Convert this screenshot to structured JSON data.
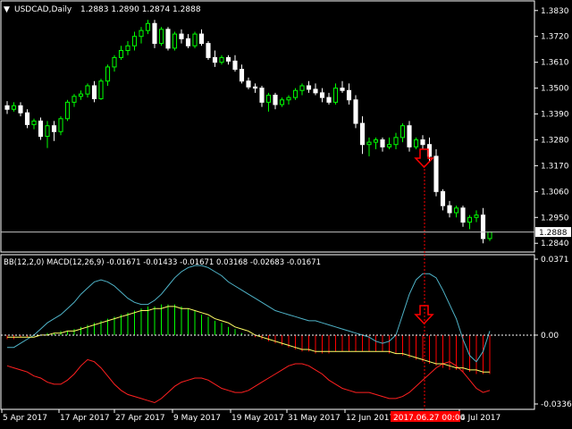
{
  "header": {
    "arrow": "▼",
    "symbol": "USDCAD,Daily",
    "ohlc": "1.2883 1.2890 1.2874 1.2888"
  },
  "price_axis": {
    "ticks": [
      "1.3830",
      "1.3720",
      "1.3610",
      "1.3500",
      "1.3390",
      "1.3280",
      "1.3170",
      "1.3060",
      "1.2950",
      "1.2840"
    ],
    "current": "1.2888"
  },
  "indicator": {
    "title": "BB(12,2,0) MACD(12,26,9) -0.01671 -0.01433 -0.01671 0.03168 -0.02683 -0.01671",
    "ticks": [
      "0.0371",
      "0.00",
      "-0.03365"
    ]
  },
  "time_axis": {
    "labels": [
      "5 Apr 2017",
      "17 Apr 2017",
      "27 Apr 2017",
      "9 May 2017",
      "19 May 2017",
      "31 May 2017",
      "12 Jun 2017",
      "4 Jul 2017"
    ],
    "crosshair_label": "2017.06.27 00:00"
  },
  "colors": {
    "bull": "#00ff00",
    "bear": "#ffffff",
    "macd_up": "#00ff00",
    "macd_down": "#ff0000",
    "bb_upper": "#4fb3c8",
    "bb_lower": "#ff2020",
    "signal": "#ffff66",
    "crosshair": "#ff0000",
    "arrow": "#ff0000"
  },
  "chart_data": {
    "type": "candlestick",
    "ohlc_order": [
      "open",
      "high",
      "low",
      "close"
    ],
    "candles": [
      [
        1.3425,
        1.3445,
        1.339,
        1.341
      ],
      [
        1.341,
        1.344,
        1.34,
        1.3425
      ],
      [
        1.3425,
        1.344,
        1.338,
        1.3395
      ],
      [
        1.3395,
        1.341,
        1.333,
        1.3345
      ],
      [
        1.3345,
        1.337,
        1.3325,
        1.336
      ],
      [
        1.336,
        1.3375,
        1.328,
        1.3295
      ],
      [
        1.3295,
        1.336,
        1.3245,
        1.334
      ],
      [
        1.334,
        1.336,
        1.3275,
        1.3315
      ],
      [
        1.3315,
        1.338,
        1.33,
        1.337
      ],
      [
        1.337,
        1.345,
        1.336,
        1.344
      ],
      [
        1.344,
        1.3475,
        1.342,
        1.3465
      ],
      [
        1.3465,
        1.349,
        1.345,
        1.3475
      ],
      [
        1.3475,
        1.352,
        1.346,
        1.351
      ],
      [
        1.351,
        1.353,
        1.344,
        1.3455
      ],
      [
        1.3455,
        1.354,
        1.345,
        1.353
      ],
      [
        1.353,
        1.36,
        1.351,
        1.359
      ],
      [
        1.359,
        1.364,
        1.357,
        1.363
      ],
      [
        1.363,
        1.368,
        1.362,
        1.366
      ],
      [
        1.366,
        1.37,
        1.364,
        1.368
      ],
      [
        1.368,
        1.374,
        1.366,
        1.372
      ],
      [
        1.372,
        1.376,
        1.369,
        1.3745
      ],
      [
        1.3745,
        1.379,
        1.373,
        1.3775
      ],
      [
        1.3775,
        1.379,
        1.367,
        1.369
      ],
      [
        1.369,
        1.376,
        1.368,
        1.375
      ],
      [
        1.375,
        1.376,
        1.366,
        1.367
      ],
      [
        1.367,
        1.374,
        1.366,
        1.373
      ],
      [
        1.373,
        1.375,
        1.369,
        1.371
      ],
      [
        1.371,
        1.373,
        1.367,
        1.368
      ],
      [
        1.368,
        1.374,
        1.367,
        1.373
      ],
      [
        1.373,
        1.375,
        1.368,
        1.369
      ],
      [
        1.369,
        1.37,
        1.362,
        1.363
      ],
      [
        1.363,
        1.366,
        1.359,
        1.361
      ],
      [
        1.361,
        1.364,
        1.36,
        1.363
      ],
      [
        1.363,
        1.364,
        1.36,
        1.3615
      ],
      [
        1.3615,
        1.364,
        1.357,
        1.358
      ],
      [
        1.358,
        1.36,
        1.352,
        1.353
      ],
      [
        1.353,
        1.3545,
        1.3495,
        1.3505
      ],
      [
        1.3505,
        1.352,
        1.348,
        1.35
      ],
      [
        1.35,
        1.351,
        1.342,
        1.344
      ],
      [
        1.344,
        1.348,
        1.34,
        1.347
      ],
      [
        1.347,
        1.348,
        1.341,
        1.343
      ],
      [
        1.343,
        1.346,
        1.342,
        1.345
      ],
      [
        1.345,
        1.347,
        1.343,
        1.346
      ],
      [
        1.346,
        1.35,
        1.345,
        1.349
      ],
      [
        1.349,
        1.352,
        1.347,
        1.351
      ],
      [
        1.351,
        1.353,
        1.348,
        1.3495
      ],
      [
        1.3495,
        1.352,
        1.347,
        1.348
      ],
      [
        1.348,
        1.35,
        1.344,
        1.346
      ],
      [
        1.346,
        1.348,
        1.343,
        1.344
      ],
      [
        1.344,
        1.352,
        1.343,
        1.35
      ],
      [
        1.35,
        1.353,
        1.348,
        1.349
      ],
      [
        1.349,
        1.352,
        1.343,
        1.345
      ],
      [
        1.345,
        1.347,
        1.333,
        1.335
      ],
      [
        1.335,
        1.338,
        1.322,
        1.326
      ],
      [
        1.326,
        1.329,
        1.321,
        1.327
      ],
      [
        1.327,
        1.329,
        1.324,
        1.328
      ],
      [
        1.328,
        1.329,
        1.323,
        1.325
      ],
      [
        1.325,
        1.329,
        1.324,
        1.326
      ],
      [
        1.326,
        1.331,
        1.324,
        1.329
      ],
      [
        1.329,
        1.335,
        1.327,
        1.334
      ],
      [
        1.334,
        1.336,
        1.323,
        1.325
      ],
      [
        1.325,
        1.329,
        1.324,
        1.328
      ],
      [
        1.328,
        1.33,
        1.324,
        1.326
      ],
      [
        1.326,
        1.329,
        1.319,
        1.321
      ],
      [
        1.321,
        1.324,
        1.304,
        1.306
      ],
      [
        1.306,
        1.307,
        1.298,
        1.3
      ],
      [
        1.3,
        1.302,
        1.295,
        1.297
      ],
      [
        1.297,
        1.3,
        1.295,
        1.299
      ],
      [
        1.299,
        1.3,
        1.291,
        1.293
      ],
      [
        1.293,
        1.296,
        1.29,
        1.295
      ],
      [
        1.295,
        1.298,
        1.293,
        1.296
      ],
      [
        1.296,
        1.299,
        1.284,
        1.286
      ],
      [
        1.286,
        1.289,
        1.285,
        1.2888
      ]
    ],
    "price_ylim": [
      1.2818,
      1.3852
    ],
    "indicator_ylim": [
      -0.03365,
      0.0371
    ],
    "bb_upper": [
      -0.006,
      -0.006,
      -0.004,
      -0.002,
      0.0,
      0.003,
      0.006,
      0.008,
      0.01,
      0.013,
      0.016,
      0.02,
      0.023,
      0.026,
      0.027,
      0.026,
      0.024,
      0.021,
      0.018,
      0.016,
      0.015,
      0.015,
      0.017,
      0.02,
      0.024,
      0.028,
      0.031,
      0.033,
      0.034,
      0.034,
      0.033,
      0.031,
      0.029,
      0.026,
      0.024,
      0.022,
      0.02,
      0.018,
      0.016,
      0.014,
      0.012,
      0.011,
      0.01,
      0.009,
      0.008,
      0.007,
      0.007,
      0.006,
      0.005,
      0.004,
      0.003,
      0.002,
      0.001,
      0.0,
      -0.001,
      -0.003,
      -0.004,
      -0.003,
      0.0,
      0.01,
      0.02,
      0.027,
      0.03,
      0.03,
      0.028,
      0.022,
      0.015,
      0.008,
      -0.002,
      -0.01,
      -0.013,
      -0.008,
      0.002
    ],
    "bb_lower": [
      -0.015,
      -0.016,
      -0.017,
      -0.018,
      -0.02,
      -0.021,
      -0.023,
      -0.024,
      -0.024,
      -0.022,
      -0.019,
      -0.015,
      -0.012,
      -0.013,
      -0.016,
      -0.02,
      -0.024,
      -0.027,
      -0.029,
      -0.03,
      -0.031,
      -0.032,
      -0.033,
      -0.031,
      -0.028,
      -0.025,
      -0.023,
      -0.022,
      -0.021,
      -0.021,
      -0.022,
      -0.024,
      -0.026,
      -0.027,
      -0.028,
      -0.028,
      -0.027,
      -0.025,
      -0.023,
      -0.021,
      -0.019,
      -0.017,
      -0.015,
      -0.014,
      -0.014,
      -0.015,
      -0.017,
      -0.019,
      -0.022,
      -0.024,
      -0.026,
      -0.027,
      -0.028,
      -0.028,
      -0.028,
      -0.029,
      -0.03,
      -0.031,
      -0.031,
      -0.03,
      -0.028,
      -0.025,
      -0.022,
      -0.019,
      -0.016,
      -0.014,
      -0.013,
      -0.015,
      -0.018,
      -0.022,
      -0.026,
      -0.028,
      -0.027
    ],
    "macd_hist": [
      -0.002,
      -0.002,
      -0.001,
      -0.001,
      0.0,
      0.0,
      0.001,
      0.001,
      0.002,
      0.002,
      0.003,
      0.004,
      0.005,
      0.006,
      0.007,
      0.008,
      0.009,
      0.01,
      0.011,
      0.012,
      0.013,
      0.014,
      0.014,
      0.015,
      0.015,
      0.015,
      0.014,
      0.013,
      0.012,
      0.01,
      0.009,
      0.007,
      0.006,
      0.004,
      0.003,
      0.001,
      0.0,
      -0.001,
      -0.002,
      -0.003,
      -0.004,
      -0.005,
      -0.006,
      -0.007,
      -0.008,
      -0.008,
      -0.009,
      -0.009,
      -0.009,
      -0.008,
      -0.008,
      -0.008,
      -0.008,
      -0.008,
      -0.008,
      -0.008,
      -0.008,
      -0.009,
      -0.009,
      -0.01,
      -0.011,
      -0.012,
      -0.013,
      -0.014,
      -0.015,
      -0.016,
      -0.017,
      -0.017,
      -0.018,
      -0.018,
      -0.019,
      -0.019,
      -0.019
    ],
    "macd_signal": [
      -0.001,
      -0.001,
      -0.001,
      -0.001,
      -0.001,
      0.0,
      0.0,
      0.001,
      0.001,
      0.002,
      0.002,
      0.003,
      0.004,
      0.005,
      0.006,
      0.007,
      0.008,
      0.009,
      0.01,
      0.011,
      0.012,
      0.012,
      0.013,
      0.013,
      0.014,
      0.014,
      0.013,
      0.013,
      0.012,
      0.011,
      0.01,
      0.008,
      0.007,
      0.006,
      0.004,
      0.003,
      0.002,
      0.0,
      -0.001,
      -0.002,
      -0.003,
      -0.004,
      -0.005,
      -0.006,
      -0.007,
      -0.007,
      -0.008,
      -0.008,
      -0.008,
      -0.008,
      -0.008,
      -0.008,
      -0.008,
      -0.008,
      -0.008,
      -0.008,
      -0.008,
      -0.008,
      -0.009,
      -0.009,
      -0.01,
      -0.011,
      -0.012,
      -0.013,
      -0.014,
      -0.014,
      -0.015,
      -0.016,
      -0.016,
      -0.017,
      -0.017,
      -0.018,
      -0.018
    ]
  }
}
